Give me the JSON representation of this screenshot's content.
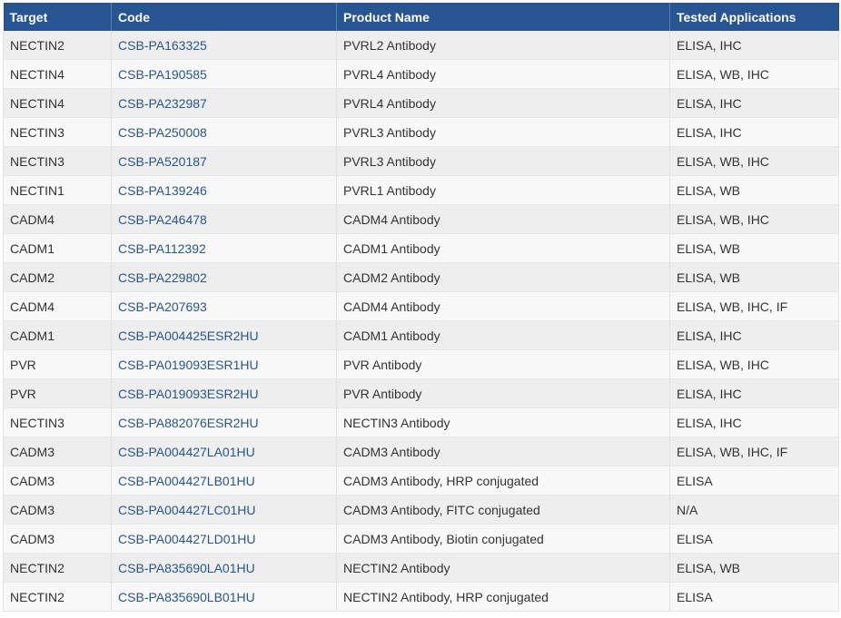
{
  "table": {
    "headers": [
      "Target",
      "Code",
      "Product Name",
      "Tested Applications"
    ],
    "rows": [
      {
        "target": "NECTIN2",
        "code": "CSB-PA163325",
        "product": "PVRL2 Antibody",
        "apps": "ELISA, IHC"
      },
      {
        "target": "NECTIN4",
        "code": "CSB-PA190585",
        "product": "PVRL4 Antibody",
        "apps": "ELISA, WB, IHC"
      },
      {
        "target": "NECTIN4",
        "code": "CSB-PA232987",
        "product": "PVRL4 Antibody",
        "apps": "ELISA, IHC"
      },
      {
        "target": "NECTIN3",
        "code": "CSB-PA250008",
        "product": "PVRL3 Antibody",
        "apps": "ELISA, IHC"
      },
      {
        "target": "NECTIN3",
        "code": "CSB-PA520187",
        "product": "PVRL3 Antibody",
        "apps": "ELISA, WB, IHC"
      },
      {
        "target": "NECTIN1",
        "code": "CSB-PA139246",
        "product": "PVRL1 Antibody",
        "apps": "ELISA, WB"
      },
      {
        "target": "CADM4",
        "code": "CSB-PA246478",
        "product": "CADM4 Antibody",
        "apps": "ELISA, WB, IHC"
      },
      {
        "target": "CADM1",
        "code": "CSB-PA112392",
        "product": "CADM1 Antibody",
        "apps": "ELISA, WB"
      },
      {
        "target": "CADM2",
        "code": "CSB-PA229802",
        "product": "CADM2 Antibody",
        "apps": "ELISA, WB"
      },
      {
        "target": "CADM4",
        "code": "CSB-PA207693",
        "product": "CADM4 Antibody",
        "apps": "ELISA, WB, IHC, IF"
      },
      {
        "target": "CADM1",
        "code": "CSB-PA004425ESR2HU",
        "product": "CADM1 Antibody",
        "apps": "ELISA, IHC"
      },
      {
        "target": "PVR",
        "code": "CSB-PA019093ESR1HU",
        "product": "PVR Antibody",
        "apps": "ELISA, WB, IHC"
      },
      {
        "target": "PVR",
        "code": "CSB-PA019093ESR2HU",
        "product": "PVR Antibody",
        "apps": "ELISA, IHC"
      },
      {
        "target": "NECTIN3",
        "code": "CSB-PA882076ESR2HU",
        "product": "NECTIN3 Antibody",
        "apps": "ELISA, IHC"
      },
      {
        "target": "CADM3",
        "code": "CSB-PA004427LA01HU",
        "product": "CADM3 Antibody",
        "apps": "ELISA, WB, IHC, IF"
      },
      {
        "target": "CADM3",
        "code": "CSB-PA004427LB01HU",
        "product": "CADM3 Antibody, HRP conjugated",
        "apps": "ELISA"
      },
      {
        "target": "CADM3",
        "code": "CSB-PA004427LC01HU",
        "product": "CADM3 Antibody, FITC conjugated",
        "apps": "N/A"
      },
      {
        "target": "CADM3",
        "code": "CSB-PA004427LD01HU",
        "product": "CADM3 Antibody, Biotin conjugated",
        "apps": "ELISA"
      },
      {
        "target": "NECTIN2",
        "code": "CSB-PA835690LA01HU",
        "product": "NECTIN2 Antibody",
        "apps": "ELISA, WB"
      },
      {
        "target": "NECTIN2",
        "code": "CSB-PA835690LB01HU",
        "product": "NECTIN2 Antibody, HRP conjugated",
        "apps": "ELISA"
      }
    ]
  },
  "colors": {
    "header_bg": "#275591",
    "link": "#275591",
    "row_odd": "#eeeeee",
    "row_even": "#f8f8f8"
  }
}
